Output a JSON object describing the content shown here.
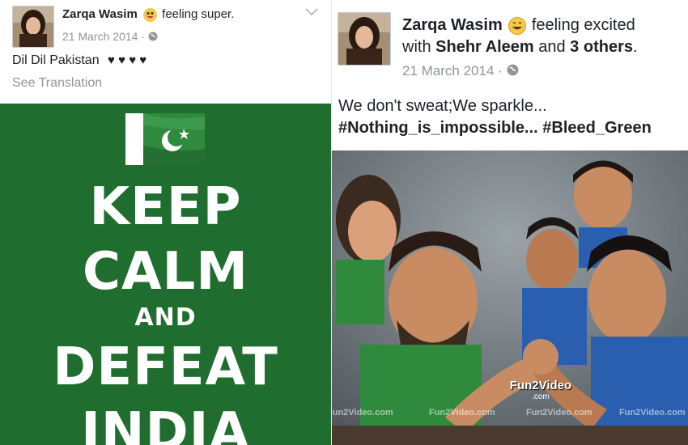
{
  "left_post": {
    "author": "Zarqa Wasim",
    "feeling": "feeling super.",
    "date": "21 March 2014",
    "privacy_separator": "·",
    "text": "Dil Dil Pakistan",
    "hearts": "♥ ♥ ♥ ♥",
    "see_translation": "See Translation",
    "image": {
      "line1": "KEEP",
      "line2": "CALM",
      "line3": "AND",
      "line4": "DEFEAT",
      "line5": "INDIA"
    }
  },
  "right_post": {
    "author": "Zarqa Wasim",
    "feeling": "feeling excited",
    "with_prefix": "with",
    "with_name": "Shehr Aleem",
    "and_word": "and",
    "others": "3 others",
    "period": ".",
    "date": "21 March 2014",
    "privacy_separator": "·",
    "text_line1": "We don't sweat;We sparkle...",
    "text_line2": "#Nothing_is_impossible... #Bleed_Green",
    "image": {
      "logo_top": "Fun2Video",
      "logo_bottom": ".com",
      "watermark": "Fun2Video.com"
    }
  },
  "colors": {
    "poster_green": "#1f6d2f",
    "meta_grey": "#90949c",
    "emoji_yellow": "#f7c948"
  }
}
